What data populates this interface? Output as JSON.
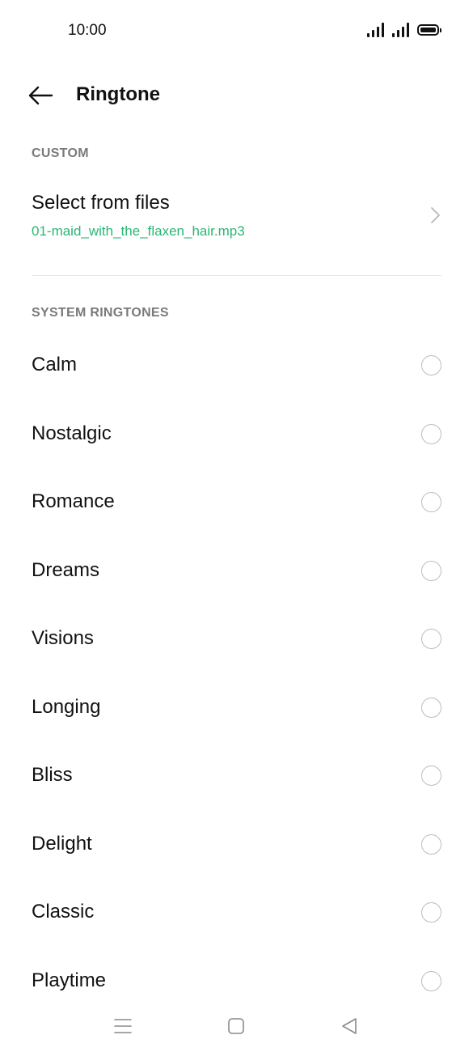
{
  "status_bar": {
    "time": "10:00",
    "icons": [
      "signal-icon",
      "signal-icon",
      "battery-icon"
    ]
  },
  "header": {
    "back_icon": "arrow-left-icon",
    "title": "Ringtone"
  },
  "custom_section": {
    "label": "CUSTOM",
    "file_row": {
      "title": "Select from files",
      "filename": "01-maid_with_the_flaxen_hair.mp3",
      "chevron_icon": "chevron-right-icon"
    }
  },
  "system_section": {
    "label": "SYSTEM RINGTONES",
    "items": [
      {
        "label": "Calm",
        "selected": false
      },
      {
        "label": "Nostalgic",
        "selected": false
      },
      {
        "label": "Romance",
        "selected": false
      },
      {
        "label": "Dreams",
        "selected": false
      },
      {
        "label": "Visions",
        "selected": false
      },
      {
        "label": "Longing",
        "selected": false
      },
      {
        "label": "Bliss",
        "selected": false
      },
      {
        "label": "Delight",
        "selected": false
      },
      {
        "label": "Classic",
        "selected": false
      },
      {
        "label": "Playtime",
        "selected": false
      }
    ]
  },
  "nav_bar": {
    "icons": [
      "menu-icon",
      "home-icon",
      "back-triangle-icon"
    ]
  },
  "colors": {
    "accent": "#2bb673",
    "section_label": "#7a7a7a",
    "divider": "#e6e6e6",
    "radio_border": "#bdbdbd"
  }
}
